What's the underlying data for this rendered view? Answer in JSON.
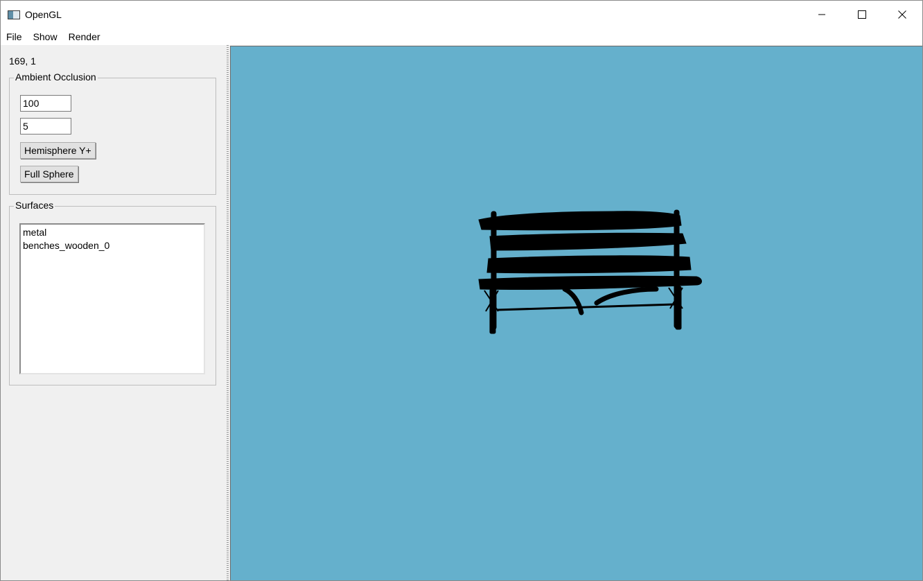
{
  "window": {
    "title": "OpenGL",
    "controls": {
      "minimize": "—",
      "maximize": "☐",
      "close": "✕"
    }
  },
  "menu": {
    "items": [
      "File",
      "Show",
      "Render"
    ]
  },
  "sidebar": {
    "coords": "169, 1",
    "ambient_occlusion": {
      "title": "Ambient Occlusion",
      "field1_value": "100",
      "field2_value": "5",
      "hemisphere_button": "Hemisphere Y+",
      "full_sphere_button": "Full Sphere"
    },
    "surfaces": {
      "title": "Surfaces",
      "items": [
        "metal",
        "benches_wooden_0"
      ]
    }
  },
  "viewport": {
    "background_color": "#65b0cc",
    "model": "bench-silhouette"
  }
}
